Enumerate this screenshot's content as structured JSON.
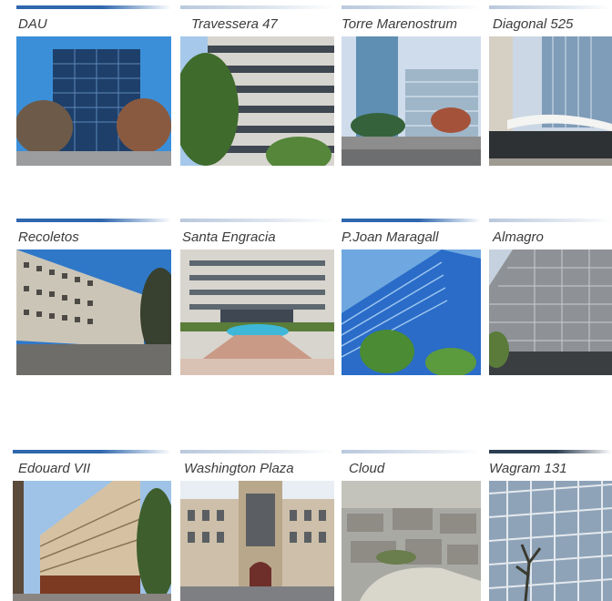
{
  "colors": {
    "accent": "#2f67ad"
  },
  "buildings": [
    {
      "name": "DAU",
      "image": "modern glass office tower with bare trees, blue sky"
    },
    {
      "name": "Travessera 47",
      "image": "concrete office building with horizontal bands and trees"
    },
    {
      "name": "Torre Marenostrum",
      "image": "glass towers by a waterfront boulevard"
    },
    {
      "name": "Diagonal 525",
      "image": "curved glass office block with white balconies"
    },
    {
      "name": "Recoletos",
      "image": "white perforated facade residential/office block"
    },
    {
      "name": "Santa Engracia",
      "image": "office building with courtyard fountain"
    },
    {
      "name": "P.Joan Maragall",
      "image": "blue glass office building with trees"
    },
    {
      "name": "Almagro",
      "image": "grey grid facade office building"
    },
    {
      "name": "Edouard VII",
      "image": "Parisian haussmann corner building"
    },
    {
      "name": "Washington Plaza",
      "image": "Parisian stone facade office with arched entrance"
    },
    {
      "name": "Cloud",
      "image": "aerial view of Paris rooftops"
    },
    {
      "name": "Wagram 131",
      "image": "glass grid facade office with trees"
    }
  ]
}
